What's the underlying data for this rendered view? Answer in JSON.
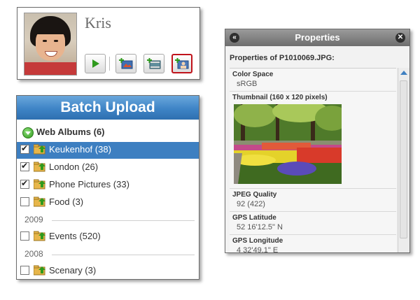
{
  "profile": {
    "name": "Kris",
    "buttons": [
      {
        "icon": "play-icon"
      },
      {
        "icon": "add-photo-icon"
      },
      {
        "icon": "add-video-icon"
      },
      {
        "icon": "add-person-icon",
        "selected": true
      }
    ]
  },
  "batch": {
    "title": "Batch Upload",
    "albums_header": "Web Albums (6)",
    "rows": [
      {
        "label": "Keukenhof (38)",
        "checked": true,
        "selected": true
      },
      {
        "label": "London (26)",
        "checked": true,
        "selected": false
      },
      {
        "label": "Phone Pictures (33)",
        "checked": true,
        "selected": false
      },
      {
        "label": "Food (3)",
        "checked": false,
        "selected": false
      }
    ],
    "year_2009": "2009",
    "rows_2009": [
      {
        "label": "Events (520)",
        "checked": false
      }
    ],
    "year_2008": "2008",
    "rows_2008": [
      {
        "label": "Scenary (3)",
        "checked": false
      }
    ]
  },
  "properties": {
    "title": "Properties",
    "heading": "Properties of P1010069.JPG:",
    "color_space_label": "Color Space",
    "color_space_value": "sRGB",
    "thumbnail_label": "Thumbnail (160 x 120 pixels)",
    "jpeg_quality_label": "JPEG Quality",
    "jpeg_quality_value": "92 (422)",
    "gps_lat_label": "GPS Latitude",
    "gps_lat_value": "52 16'12.5\" N",
    "gps_lon_label": "GPS Longitude",
    "gps_lon_value": "4 32'49.1\" E"
  },
  "colors": {
    "accent_blue": "#3d7fc1",
    "selected_border": "#c0131b"
  }
}
